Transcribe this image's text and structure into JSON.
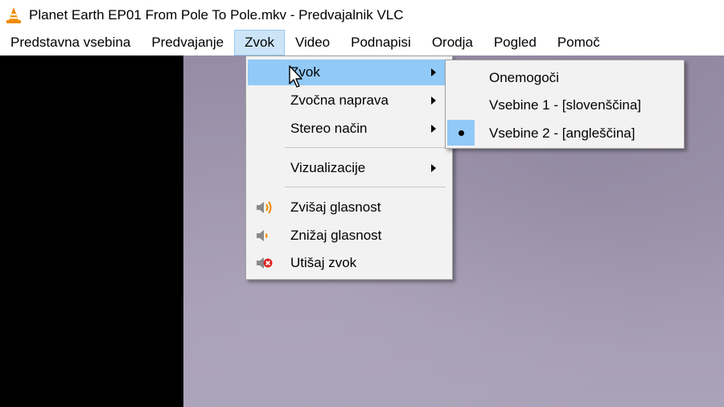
{
  "window": {
    "title": "Planet Earth EP01 From Pole To Pole.mkv - Predvajalnik VLC",
    "icon": "vlc-cone-icon"
  },
  "menubar": {
    "items": [
      "Predstavna vsebina",
      "Predvajanje",
      "Zvok",
      "Video",
      "Podnapisi",
      "Orodja",
      "Pogled",
      "Pomoč"
    ],
    "active": "Zvok"
  },
  "audio_menu": {
    "items": [
      {
        "label": "Zvok",
        "submenu": true,
        "highlighted": true
      },
      {
        "label": "Zvočna naprava",
        "submenu": true
      },
      {
        "label": "Stereo način",
        "submenu": true
      },
      {
        "label": "Vizualizacije",
        "submenu": true
      },
      {
        "label": "Zvišaj glasnost",
        "icon": "volume-up-icon"
      },
      {
        "label": "Znižaj glasnost",
        "icon": "volume-down-icon"
      },
      {
        "label": "Utišaj zvok",
        "icon": "mute-icon"
      }
    ]
  },
  "audio_track_submenu": {
    "items": [
      {
        "label": "Onemogoči"
      },
      {
        "label": "Vsebine 1 - [slovenščina]"
      },
      {
        "label": "Vsebine 2 - [angleščina]",
        "selected": true
      }
    ]
  },
  "colors": {
    "highlight": "#91c9f7",
    "menu_active": "#cce4f7",
    "vlc_orange": "#f08a00"
  }
}
